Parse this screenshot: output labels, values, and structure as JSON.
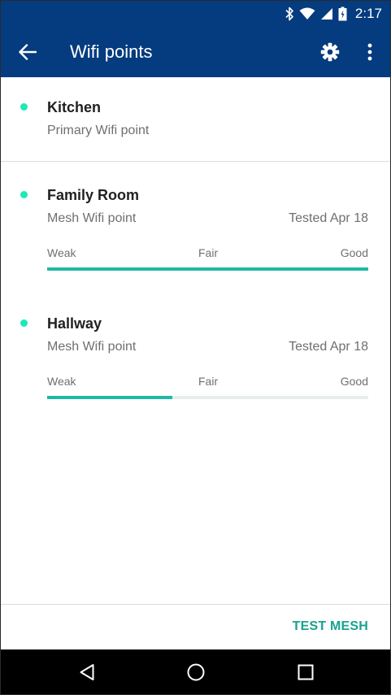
{
  "status_bar": {
    "time": "2:17",
    "icons": [
      "bluetooth-icon",
      "wifi-icon",
      "cell-signal-icon",
      "battery-icon"
    ]
  },
  "app_bar": {
    "title": "Wifi points",
    "back_icon": "arrow-back-icon",
    "settings_icon": "gear-icon",
    "overflow_icon": "more-vert-icon"
  },
  "colors": {
    "header_bg": "#053b7f",
    "status_dot": "#1de9b6",
    "bar_fill": "#1eb9a6",
    "bar_track": "#e6eeee",
    "action_text": "#17a38f"
  },
  "points": [
    {
      "name": "Kitchen",
      "type": "Primary Wifi point"
    },
    {
      "name": "Family Room",
      "type": "Mesh Wifi point",
      "tested": "Tested Apr 18",
      "scale": [
        "Weak",
        "Fair",
        "Good"
      ],
      "signal_fraction": 1.0
    },
    {
      "name": "Hallway",
      "type": "Mesh Wifi point",
      "tested": "Tested Apr 18",
      "scale": [
        "Weak",
        "Fair",
        "Good"
      ],
      "signal_fraction": 0.39
    }
  ],
  "actions": {
    "test_mesh": "TEST MESH"
  },
  "nav_bar": {
    "icons": [
      "back-triangle-icon",
      "home-circle-icon",
      "recents-square-icon"
    ]
  }
}
